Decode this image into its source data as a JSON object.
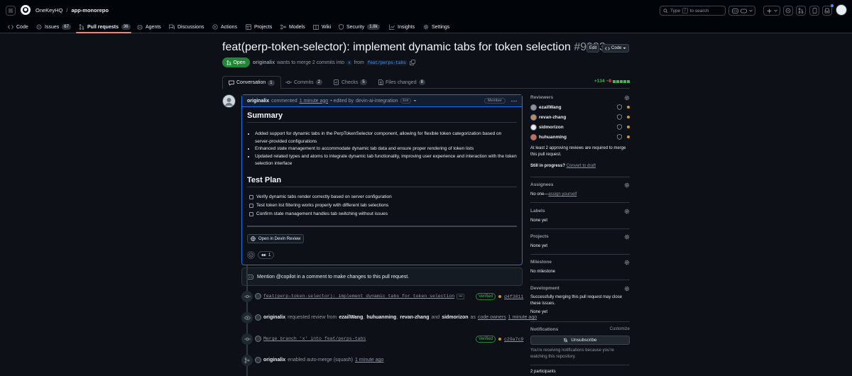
{
  "header": {
    "org": "OneKeyHQ",
    "separator": "/",
    "repo": "app-monorepo",
    "search_prefix": "Type",
    "search_key": "/",
    "search_suffix": "to search"
  },
  "nav": {
    "tabs": [
      {
        "label": "Code",
        "icon": "code-icon"
      },
      {
        "label": "Issues",
        "icon": "issue-icon",
        "count": "67"
      },
      {
        "label": "Pull requests",
        "icon": "pull-request-icon",
        "count": "36"
      },
      {
        "label": "Agents",
        "icon": "agents-icon"
      },
      {
        "label": "Discussions",
        "icon": "discussions-icon"
      },
      {
        "label": "Actions",
        "icon": "actions-icon"
      },
      {
        "label": "Projects",
        "icon": "projects-icon"
      },
      {
        "label": "Models",
        "icon": "models-icon"
      },
      {
        "label": "Wiki",
        "icon": "wiki-icon"
      },
      {
        "label": "Security",
        "icon": "shield-icon",
        "count": "1.8k"
      },
      {
        "label": "Insights",
        "icon": "graph-icon"
      },
      {
        "label": "Settings",
        "icon": "gear-icon"
      }
    ]
  },
  "pr": {
    "title": "feat(perp-token-selector): implement dynamic tabs for token selection",
    "number": "#9983",
    "edit_label": "Edit",
    "code_label": "Code",
    "state": "Open",
    "author": "originalix",
    "merge_text": "wants to merge 2 commits into",
    "base_branch": "x",
    "from_text": "from",
    "head_branch": "feat/perps-tabs",
    "tabs": [
      {
        "label": "Conversation",
        "count": "1"
      },
      {
        "label": "Commits",
        "count": "2"
      },
      {
        "label": "Checks",
        "count": "5"
      },
      {
        "label": "Files changed",
        "count": "8"
      }
    ],
    "additions": "+134",
    "deletions": "−8"
  },
  "comment": {
    "author": "originalix",
    "action": "commented",
    "time": "1 minute ago",
    "edited_prefix": "• edited by",
    "editor": "devin-ai-integration",
    "bot_label": "bot",
    "role": "Member",
    "summary_heading": "Summary",
    "summary_items": [
      "Added support for dynamic tabs in the PerpTokenSelector component, allowing for flexible token categorization based on server-provided configurations",
      "Enhanced state management to accommodate dynamic tab data and ensure proper rendering of token lists",
      "Updated related types and atoms to integrate dynamic tab functionality, improving user experience and interaction with the token selection interface"
    ],
    "test_heading": "Test Plan",
    "test_items": [
      "Verify dynamic tabs render correctly based on server configuration",
      "Test token list filtering works properly with different tab selections",
      "Confirm state management handles tab switching without issues"
    ],
    "devin_button": "Open in Devin Review",
    "reaction_count": "1"
  },
  "copilot": {
    "text": "Mention @copilot in a comment to make changes to this pull request."
  },
  "timeline": {
    "commit1": {
      "message": "feat(perp-token-selector): implement dynamic tabs for token selection",
      "verified": "Verified",
      "sha": "d4f3811"
    },
    "review": {
      "author": "originalix",
      "text1": "requested review from",
      "r1": "ezailWang",
      "r2": "huhuanming",
      "r3": "revan-zhang",
      "and": "and",
      "r4": "sidmorizon",
      "as": "as",
      "owners": "code owners",
      "time": "1 minute ago"
    },
    "commit2": {
      "message": "Merge branch 'x' into feat/perps-tabs",
      "verified": "Verified",
      "sha": "c29a7c9"
    },
    "automerge": {
      "author": "originalix",
      "text": "enabled auto-merge (squash)",
      "time": "1 minute ago"
    }
  },
  "sidebar": {
    "reviewers_title": "Reviewers",
    "reviewers": [
      "ezailWang",
      "revan-zhang",
      "sidmorizon",
      "huhuanming"
    ],
    "review_note": "At least 2 approving reviews are required to merge this pull request.",
    "still_progress": "Still in progress?",
    "convert_draft": "Convert to draft",
    "assignees_title": "Assignees",
    "assignees_none": "No one—",
    "assign_yourself": "assign yourself",
    "labels_title": "Labels",
    "labels_value": "None yet",
    "projects_title": "Projects",
    "projects_value": "None yet",
    "milestone_title": "Milestone",
    "milestone_value": "No milestone",
    "development_title": "Development",
    "development_note": "Successfully merging this pull request may close these issues.",
    "development_value": "None yet",
    "notifications_title": "Notifications",
    "customize": "Customize",
    "unsubscribe": "Unsubscribe",
    "notif_note": "You're receiving notifications because you're watching this repository.",
    "participants": "2 participants"
  },
  "colors": {
    "accent": "#4493f8",
    "open_green": "#238636",
    "pending": "#d29922",
    "additions": "#3fb950",
    "deletions": "#f85149"
  }
}
